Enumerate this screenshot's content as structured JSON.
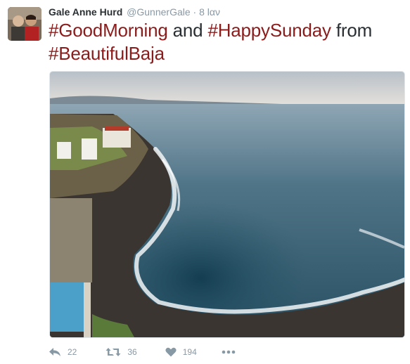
{
  "tweet": {
    "author": {
      "name": "Gale Anne Hurd",
      "handle": "@GunnerGale",
      "separator": "·",
      "time": "8 lαν"
    },
    "text": {
      "part1": "#GoodMorning",
      "part2": " and ",
      "part3": "#HappySunday",
      "part4": " from ",
      "part5": "#BeautifulBaja"
    },
    "hashtag_color": "#8b1c1c",
    "actions": {
      "reply": {
        "icon": "reply-icon",
        "count": "22"
      },
      "retweet": {
        "icon": "retweet-icon",
        "count": "36"
      },
      "like": {
        "icon": "heart-icon",
        "count": "194"
      },
      "more": {
        "icon": "more-dots-icon"
      }
    }
  }
}
